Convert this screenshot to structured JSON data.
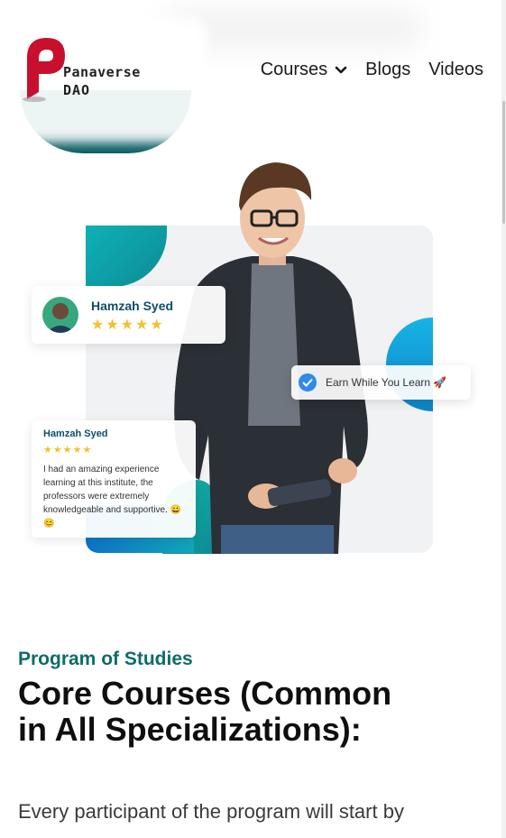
{
  "header": {
    "logo": {
      "line1": "Panaverse",
      "line2": "DAO"
    },
    "nav": [
      {
        "label": "Courses",
        "has_dropdown": true
      },
      {
        "label": "Blogs"
      },
      {
        "label": "Videos"
      }
    ]
  },
  "hero": {
    "review_card_small": {
      "name": "Hamzah Syed",
      "stars": "★★★★★"
    },
    "review_card_large": {
      "name": "Hamzah Syed",
      "stars": "★★★★★",
      "text": "I had an amazing experience learning at this institute, the professors were extremely knowledgeable and supportive. 😀😊"
    },
    "badge": {
      "label": "Earn While You Learn 🚀"
    }
  },
  "section": {
    "eyebrow": "Program of Studies",
    "title": "Core Courses (Common in All Specializations):",
    "lead": "Every participant of the program will start by"
  },
  "colors": {
    "brand_red": "#c8102e",
    "teal": "#0f6b6b",
    "star": "#f2c12e",
    "check_blue": "#2f8ae8"
  },
  "icons": [
    "chevron-down-icon",
    "checkmark-icon",
    "logo-mark-icon"
  ]
}
